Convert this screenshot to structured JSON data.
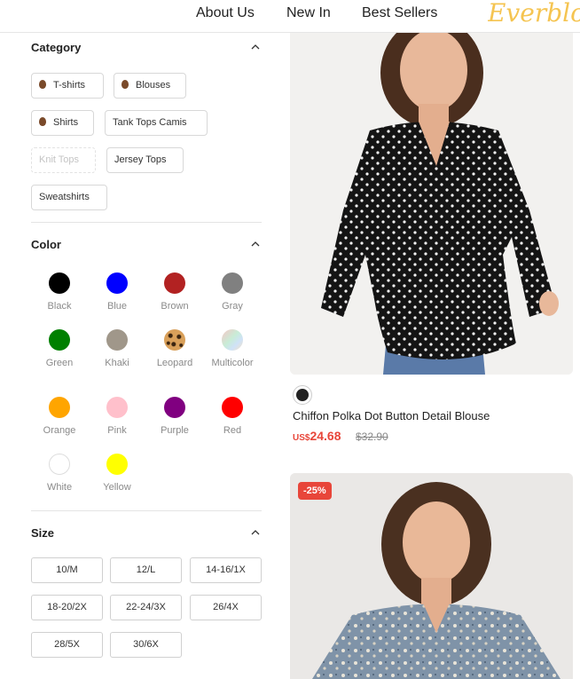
{
  "header": {
    "nav": [
      "About Us",
      "New In",
      "Best Sellers"
    ],
    "logo_text": "Everbloom"
  },
  "filters": {
    "category": {
      "title": "Category",
      "items": [
        {
          "label": "T-shirts",
          "icon": "fire-icon",
          "disabled": false
        },
        {
          "label": "Blouses",
          "icon": "fire-icon",
          "disabled": false
        },
        {
          "label": "Shirts",
          "icon": "fire-icon",
          "disabled": false
        },
        {
          "label": "Tank Tops Camis",
          "icon": "",
          "disabled": false
        },
        {
          "label": "Knit Tops",
          "icon": "",
          "disabled": true
        },
        {
          "label": "Jersey Tops",
          "icon": "",
          "disabled": false
        },
        {
          "label": "Sweatshirts",
          "icon": "",
          "disabled": false
        }
      ]
    },
    "color": {
      "title": "Color",
      "items": [
        {
          "label": "Black",
          "color": "#000000"
        },
        {
          "label": "Blue",
          "color": "#0000ff"
        },
        {
          "label": "Brown",
          "color": "#b22222"
        },
        {
          "label": "Gray",
          "color": "#808080"
        },
        {
          "label": "Green",
          "color": "#008000"
        },
        {
          "label": "Khaki",
          "color": "#a0978a"
        },
        {
          "label": "Leopard",
          "color": "leopard"
        },
        {
          "label": "Multicolor",
          "color": "multicolor"
        },
        {
          "label": "Orange",
          "color": "#ffa500"
        },
        {
          "label": "Pink",
          "color": "#ffc0cb"
        },
        {
          "label": "Purple",
          "color": "#800080"
        },
        {
          "label": "Red",
          "color": "#ff0000"
        },
        {
          "label": "White",
          "color": "#ffffff"
        },
        {
          "label": "Yellow",
          "color": "#ffff00"
        }
      ]
    },
    "size": {
      "title": "Size",
      "items": [
        "10/M",
        "12/L",
        "14-16/1X",
        "18-20/2X",
        "22-24/3X",
        "26/4X",
        "28/5X",
        "30/6X"
      ]
    }
  },
  "products": [
    {
      "title": "Chiffon Polka Dot Button Detail Blouse",
      "currency": "US$",
      "price": "24.68",
      "old_price": "$32.90",
      "badge": ""
    },
    {
      "title": "",
      "badge": "-25%"
    }
  ],
  "colors": {
    "accent": "#e8463a",
    "logo": "#f5c451"
  }
}
